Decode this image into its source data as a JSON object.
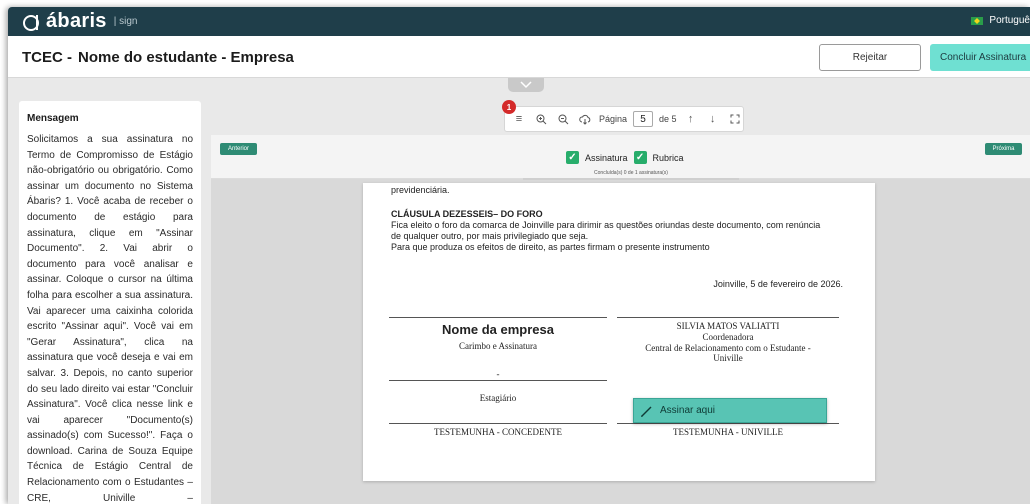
{
  "app": {
    "brand": "ábaris",
    "brand_suffix": "sign",
    "language": "Portuguê"
  },
  "header": {
    "prefix": "TCEC -",
    "title": "Nome do estudante - Empresa",
    "reject_label": "Rejeitar",
    "conclude_label": "Concluir Assinatura"
  },
  "message": {
    "title": "Mensagem",
    "body": "Solicitamos a sua assinatura no Termo de Compromisso de Estágio não-obrigatório ou obrigatório. Como assinar um documento no Sistema Ábaris? 1. Você acaba de receber o documento de estágio para assinatura, clique em \"Assinar Documento\". 2. Vai abrir o documento para você analisar e assinar. Coloque o cursor na última folha para escolher a sua assinatura. Vai aparecer uma caixinha colorida escrito \"Assinar aqui\". Você vai em \"Gerar Assinatura\", clica na assinatura que você deseja e vai em salvar. 3. Depois, no canto superior do seu lado direito vai estar \"Concluir Assinatura\". Você clica nesse link e vai aparecer \"Documento(s) assinado(s) com Sucesso!\". Faça o download. Carina de Souza Equipe Técnica de Estágio Central de Relacionamento com o Estudantes – CRE, Univille – carina.souza@univille.br"
  },
  "toolbar": {
    "badge_count": "1",
    "page_label": "Página",
    "page_value": "5",
    "page_total": "de 5"
  },
  "viewer": {
    "prev_label": "Anterior",
    "next_label": "Próxima",
    "filter_signature": "Assinatura",
    "filter_initials": "Rubrica",
    "progress_text": "Concluída(s) 0 de 1 assinatura(s)"
  },
  "document": {
    "line_previdenciaria": "previdenciária.",
    "clause_title": "CLÁUSULA DEZESSEIS– DO FORO",
    "clause_line1": "Fica eleito o foro da comarca de Joinville para dirimir as questões oriundas deste documento, com renúncia",
    "clause_line2": "de qualquer outro, por mais privilegiado que seja.",
    "clause_line3": "Para que produza os efeitos de direito, as partes firmam o presente instrumento",
    "date_line": "Joinville, 5 de fevereiro de 2026.",
    "company_name": "Nome da empresa",
    "company_sub": "Carimbo e Assinatura",
    "coord_name": "SILVIA MATOS VALIATTI",
    "coord_role": "Coordenadora",
    "coord_dept1": "Central de Relacionamento com o Estudante -",
    "coord_dept2": "Univille",
    "dash": "-",
    "intern_label": "Estagiário",
    "witness_left": "TESTEMUNHA - CONCEDENTE",
    "witness_right": "TESTEMUNHA - UNIVILLE",
    "sign_here_label": "Assinar aqui"
  },
  "colors": {
    "topbar": "#1f3e4a",
    "accent": "#6fe0d2",
    "nav_button": "#2e8b74",
    "checkbox": "#27ad6b",
    "badge": "#d42a2a"
  }
}
